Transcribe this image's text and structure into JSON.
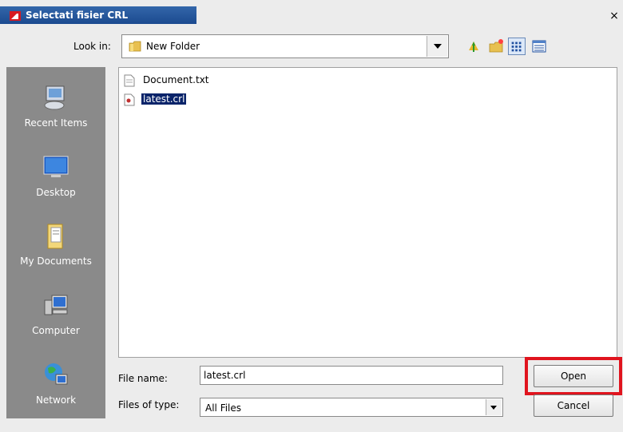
{
  "window": {
    "title": "Selectati fisier CRL",
    "close_glyph": "×"
  },
  "lookin": {
    "label": "Look in:",
    "value": "New Folder"
  },
  "places": [
    {
      "label": "Recent Items",
      "icon": "recent-items-icon"
    },
    {
      "label": "Desktop",
      "icon": "desktop-icon"
    },
    {
      "label": "My Documents",
      "icon": "my-documents-icon"
    },
    {
      "label": "Computer",
      "icon": "computer-icon"
    },
    {
      "label": "Network",
      "icon": "network-icon"
    }
  ],
  "files": [
    {
      "name": "Document.txt",
      "selected": false
    },
    {
      "name": "latest.crl",
      "selected": true
    }
  ],
  "filename": {
    "label": "File name:",
    "value": "latest.crl"
  },
  "filetype": {
    "label": "Files of type:",
    "value": "All Files"
  },
  "buttons": {
    "open": "Open",
    "cancel": "Cancel"
  },
  "colors": {
    "selection": "#0a246a",
    "highlight": "#e0141e",
    "places_bg": "#8a8a8a"
  }
}
